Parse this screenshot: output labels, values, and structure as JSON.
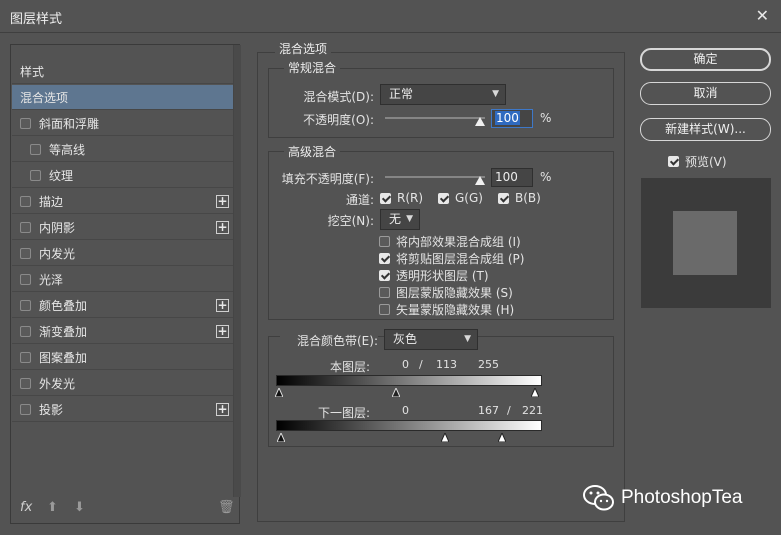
{
  "window": {
    "title": "图层样式"
  },
  "sidebar": {
    "items": [
      {
        "label": "样式",
        "checkbox": false,
        "plus": false
      },
      {
        "label": "混合选项",
        "checkbox": false,
        "plus": false,
        "selected": true
      },
      {
        "label": "斜面和浮雕",
        "checkbox": true,
        "plus": false
      },
      {
        "label": "等高线",
        "checkbox": true,
        "plus": false,
        "indent": true
      },
      {
        "label": "纹理",
        "checkbox": true,
        "plus": false,
        "indent": true
      },
      {
        "label": "描边",
        "checkbox": true,
        "plus": true
      },
      {
        "label": "内阴影",
        "checkbox": true,
        "plus": true
      },
      {
        "label": "内发光",
        "checkbox": true,
        "plus": false
      },
      {
        "label": "光泽",
        "checkbox": true,
        "plus": false
      },
      {
        "label": "颜色叠加",
        "checkbox": true,
        "plus": true
      },
      {
        "label": "渐变叠加",
        "checkbox": true,
        "plus": true
      },
      {
        "label": "图案叠加",
        "checkbox": true,
        "plus": false
      },
      {
        "label": "外发光",
        "checkbox": true,
        "plus": false
      },
      {
        "label": "投影",
        "checkbox": true,
        "plus": true
      }
    ],
    "fx_label": "fx",
    "plus_glyph": "+"
  },
  "blend": {
    "section_title": "混合选项",
    "general": {
      "title": "常规混合",
      "mode_label": "混合模式(D):",
      "mode_value": "正常",
      "opacity_label": "不透明度(O):",
      "opacity_value": "100",
      "opacity_unit": "%"
    },
    "advanced": {
      "title": "高级混合",
      "fill_label": "填充不透明度(F):",
      "fill_value": "100",
      "fill_unit": "%",
      "channels_label": "通道:",
      "channel_r": "R(R)",
      "channel_g": "G(G)",
      "channel_b": "B(B)",
      "knockout_label": "挖空(N):",
      "knockout_value": "无",
      "options": [
        {
          "label": "将内部效果混合成组 (I)",
          "checked": false
        },
        {
          "label": "将剪贴图层混合成组 (P)",
          "checked": true
        },
        {
          "label": "透明形状图层 (T)",
          "checked": true
        },
        {
          "label": "图层蒙版隐藏效果 (S)",
          "checked": false
        },
        {
          "label": "矢量蒙版隐藏效果 (H)",
          "checked": false
        }
      ]
    },
    "blend_if": {
      "label": "混合颜色带(E):",
      "value": "灰色",
      "this_layer_label": "本图层:",
      "this_layer_v1": "0",
      "this_layer_sep": "/",
      "this_layer_v2": "113",
      "this_layer_v3": "255",
      "under_layer_label": "下一图层:",
      "under_layer_v1": "0",
      "under_layer_v2": "167",
      "under_layer_sep": "/",
      "under_layer_v3": "221"
    }
  },
  "actions": {
    "ok": "确定",
    "cancel": "取消",
    "new_style": "新建样式(W)...",
    "preview_label": "预览(V)"
  },
  "watermark": "PhotoshopTea"
}
